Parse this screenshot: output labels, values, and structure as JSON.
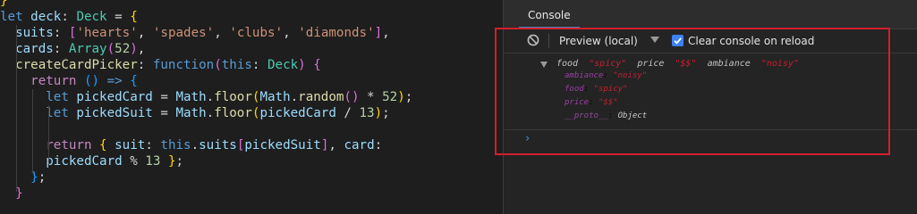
{
  "editor": {
    "lines": [
      [
        {
          "t": "}",
          "c": "tok-br1"
        }
      ],
      [
        {
          "t": "let",
          "c": "tok-kw"
        },
        {
          "t": " "
        },
        {
          "t": "deck",
          "c": "tok-var"
        },
        {
          "t": ": "
        },
        {
          "t": "Deck",
          "c": "tok-type"
        },
        {
          "t": " = "
        },
        {
          "t": "{",
          "c": "tok-br1"
        }
      ],
      [
        {
          "t": "  suits",
          "c": "tok-var"
        },
        {
          "t": ": "
        },
        {
          "t": "[",
          "c": "tok-br2"
        },
        {
          "t": "'hearts'",
          "c": "tok-str"
        },
        {
          "t": ", "
        },
        {
          "t": "'spades'",
          "c": "tok-str"
        },
        {
          "t": ", "
        },
        {
          "t": "'clubs'",
          "c": "tok-str"
        },
        {
          "t": ", "
        },
        {
          "t": "'diamonds'",
          "c": "tok-str"
        },
        {
          "t": "]",
          "c": "tok-br2"
        },
        {
          "t": ","
        }
      ],
      [
        {
          "t": "  cards",
          "c": "tok-var"
        },
        {
          "t": ": "
        },
        {
          "t": "Array",
          "c": "tok-type"
        },
        {
          "t": "(",
          "c": "tok-br2"
        },
        {
          "t": "52",
          "c": "tok-num"
        },
        {
          "t": ")",
          "c": "tok-br2"
        },
        {
          "t": ","
        }
      ],
      [
        {
          "t": "  createCardPicker",
          "c": "tok-fn"
        },
        {
          "t": ": "
        },
        {
          "t": "function",
          "c": "tok-kw"
        },
        {
          "t": "(",
          "c": "tok-br2"
        },
        {
          "t": "this",
          "c": "tok-kw"
        },
        {
          "t": ": "
        },
        {
          "t": "Deck",
          "c": "tok-type"
        },
        {
          "t": ")",
          "c": "tok-br2"
        },
        {
          "t": " "
        },
        {
          "t": "{",
          "c": "tok-br2"
        }
      ],
      [
        {
          "t": "    "
        },
        {
          "t": "return",
          "c": "tok-ctl"
        },
        {
          "t": " "
        },
        {
          "t": "()",
          "c": "tok-br3"
        },
        {
          "t": " "
        },
        {
          "t": "=>",
          "c": "tok-kw"
        },
        {
          "t": " "
        },
        {
          "t": "{",
          "c": "tok-br3"
        }
      ],
      [
        {
          "t": "      "
        },
        {
          "t": "let",
          "c": "tok-kw"
        },
        {
          "t": " "
        },
        {
          "t": "pickedCard",
          "c": "tok-var"
        },
        {
          "t": " = "
        },
        {
          "t": "Math",
          "c": "tok-var"
        },
        {
          "t": "."
        },
        {
          "t": "floor",
          "c": "tok-fn"
        },
        {
          "t": "(",
          "c": "tok-br1"
        },
        {
          "t": "Math",
          "c": "tok-var"
        },
        {
          "t": "."
        },
        {
          "t": "random",
          "c": "tok-fn"
        },
        {
          "t": "()",
          "c": "tok-br2"
        },
        {
          "t": " * "
        },
        {
          "t": "52",
          "c": "tok-num"
        },
        {
          "t": ")",
          "c": "tok-br1"
        },
        {
          "t": ";"
        }
      ],
      [
        {
          "t": "      "
        },
        {
          "t": "let",
          "c": "tok-kw"
        },
        {
          "t": " "
        },
        {
          "t": "pickedSuit",
          "c": "tok-var"
        },
        {
          "t": " = "
        },
        {
          "t": "Math",
          "c": "tok-var"
        },
        {
          "t": "."
        },
        {
          "t": "floor",
          "c": "tok-fn"
        },
        {
          "t": "(",
          "c": "tok-br1"
        },
        {
          "t": "pickedCard",
          "c": "tok-var"
        },
        {
          "t": " / "
        },
        {
          "t": "13",
          "c": "tok-num"
        },
        {
          "t": ")",
          "c": "tok-br1"
        },
        {
          "t": ";"
        }
      ],
      [],
      [
        {
          "t": "      "
        },
        {
          "t": "return",
          "c": "tok-ctl"
        },
        {
          "t": " "
        },
        {
          "t": "{",
          "c": "tok-br1"
        },
        {
          "t": " "
        },
        {
          "t": "suit",
          "c": "tok-var"
        },
        {
          "t": ": "
        },
        {
          "t": "this",
          "c": "tok-kw"
        },
        {
          "t": "."
        },
        {
          "t": "suits",
          "c": "tok-var"
        },
        {
          "t": "[",
          "c": "tok-br2"
        },
        {
          "t": "pickedSuit",
          "c": "tok-var"
        },
        {
          "t": "]",
          "c": "tok-br2"
        },
        {
          "t": ", "
        },
        {
          "t": "card",
          "c": "tok-var"
        },
        {
          "t": ":"
        }
      ],
      [
        {
          "t": "      "
        },
        {
          "t": "pickedCard",
          "c": "tok-var"
        },
        {
          "t": " % "
        },
        {
          "t": "13",
          "c": "tok-num"
        },
        {
          "t": " "
        },
        {
          "t": "}",
          "c": "tok-br1"
        },
        {
          "t": ";"
        }
      ],
      [
        {
          "t": "    "
        },
        {
          "t": "}",
          "c": "tok-br3"
        },
        {
          "t": ";"
        }
      ],
      [
        {
          "t": "  "
        },
        {
          "t": "}",
          "c": "tok-br2"
        }
      ]
    ]
  },
  "devtools": {
    "tab_label": "Console",
    "toolbar": {
      "clear_icon": "clear-console-icon",
      "preview_label": "Preview (local)",
      "checkbox_checked": true,
      "checkbox_label": "Clear console on reload"
    },
    "log": {
      "summary": [
        {
          "t": "food ",
          "c": "k-key"
        },
        {
          "t": " \"spicy\" ",
          "c": "k-str"
        },
        {
          "t": " price ",
          "c": "k-key"
        },
        {
          "t": " \"$$\" ",
          "c": "k-str"
        },
        {
          "t": " ambiance ",
          "c": "k-key"
        },
        {
          "t": " \"noisy\"",
          "c": "k-str"
        }
      ],
      "props": [
        [
          {
            "t": "ambiance",
            "c": "k-pkey"
          },
          {
            "t": ": "
          },
          {
            "t": "\"noisy\"",
            "c": "k-pstr"
          }
        ],
        [
          {
            "t": "food",
            "c": "k-pkey"
          },
          {
            "t": ": "
          },
          {
            "t": "\"spicy\"",
            "c": "k-pstr"
          }
        ],
        [
          {
            "t": "price",
            "c": "k-pkey"
          },
          {
            "t": ": "
          },
          {
            "t": "\"$$\"",
            "c": "k-pstr"
          }
        ],
        [
          {
            "t": "__proto__",
            "c": "k-proto"
          },
          {
            "t": ": "
          },
          {
            "t": "Object",
            "c": "k-obj"
          }
        ]
      ]
    },
    "prompt": "›"
  },
  "colors": {
    "editor_bg": "#1e1e1e",
    "devtools_bg": "#242424",
    "accent": "#4f86c6",
    "highlight": "#d21f2b"
  }
}
